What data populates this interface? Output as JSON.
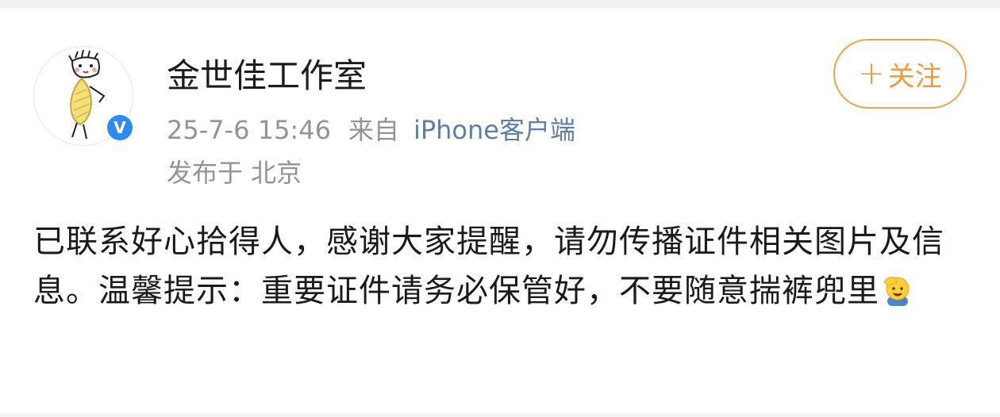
{
  "user": {
    "name": "金世佳工作室",
    "timestamp": "25-7-6 15:46",
    "from_label": "来自",
    "source": "iPhone客户端",
    "location": "发布于 北京"
  },
  "follow": {
    "plus": "+",
    "label": "关注"
  },
  "post": {
    "text": "已联系好心拾得人，感谢大家提醒，请勿传播证件相关图片及信息。温馨提示：重要证件请务必保管好，不要随意揣裤兜里",
    "emoji_icon": "salute-emoji"
  },
  "colors": {
    "accent_orange": "#ef9a3d",
    "verified_blue": "#2e8cf0",
    "link_blue": "#5e7ea8",
    "meta_gray": "#939393"
  }
}
